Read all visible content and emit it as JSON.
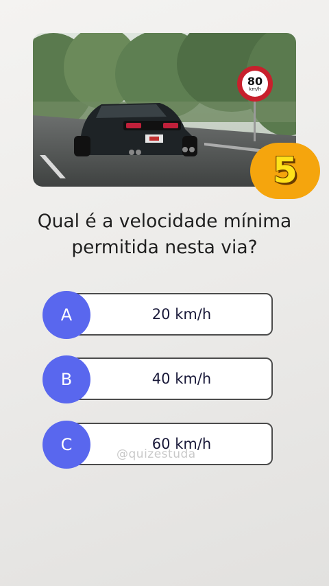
{
  "speed_sign": {
    "value": "80",
    "unit": "km/h"
  },
  "timer": {
    "count": "5"
  },
  "question": {
    "line1": "Qual é a velocidade mínima",
    "line2": "permitida nesta via?"
  },
  "options": [
    {
      "letter": "A",
      "text": "20 km/h"
    },
    {
      "letter": "B",
      "text": "40 km/h"
    },
    {
      "letter": "C",
      "text": "60 km/h"
    }
  ],
  "watermark": "@quizestuda",
  "colors": {
    "option_circle": "#5967ee",
    "timer_badge": "#f5a50d",
    "timer_digit": "#ffe21a"
  }
}
